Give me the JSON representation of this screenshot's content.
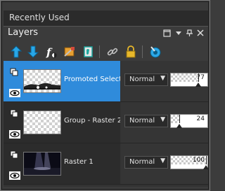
{
  "recently_used": {
    "label": "Recently Used"
  },
  "layers_panel": {
    "title": "Layers",
    "header_buttons": [
      "maximize-icon",
      "dropdown-icon",
      "pin-icon",
      "close-icon"
    ],
    "toolbar": [
      {
        "name": "new-raster-layer-icon",
        "color": "#28a7e8"
      },
      {
        "name": "new-vector-layer-icon",
        "color": "#28a7e8"
      },
      {
        "name": "adjustment-layer-icon",
        "color": "#ffffff"
      },
      {
        "name": "mask-layer-icon",
        "color": "#e8a030"
      },
      {
        "name": "new-group-icon",
        "color": "#20a8a0"
      },
      {
        "name": "link-icon",
        "color": "#c0c0c0"
      },
      {
        "name": "lock-icon",
        "color": "#e8b82a"
      },
      {
        "name": "layer-properties-icon",
        "color": "#2ba8e8"
      }
    ],
    "layers": [
      {
        "name": "Promoted Selection",
        "blend_mode": "Normal",
        "opacity": "77",
        "opacity_value": 0.77,
        "selected": true
      },
      {
        "name": "Group - Raster 2",
        "blend_mode": "Normal",
        "opacity": "24",
        "opacity_value": 0.24,
        "selected": false
      },
      {
        "name": "Raster 1",
        "blend_mode": "Normal",
        "opacity": "100",
        "opacity_value": 1.0,
        "selected": false
      }
    ]
  },
  "colors": {
    "selection": "#2f8bdb",
    "panel_bg": "#3b3b3b",
    "row_bg": "#2c2c2c"
  }
}
